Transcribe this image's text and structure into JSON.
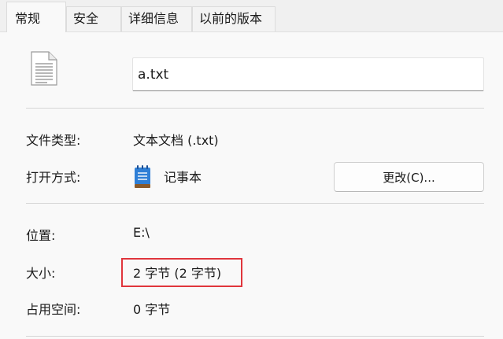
{
  "tabs": [
    {
      "label": "常规",
      "active": true
    },
    {
      "label": "安全",
      "active": false
    },
    {
      "label": "详细信息",
      "active": false
    },
    {
      "label": "以前的版本",
      "active": false
    }
  ],
  "file": {
    "name": "a.txt",
    "icon": "text-document-icon"
  },
  "properties": {
    "type_label": "文件类型:",
    "type_value": "文本文档 (.txt)",
    "openwith_label": "打开方式:",
    "openwith_value": "记事本",
    "openwith_icon": "notepad-icon",
    "change_button": "更改(C)...",
    "location_label": "位置:",
    "location_value": "E:\\",
    "size_label": "大小:",
    "size_value": "2 字节 (2 字节)",
    "size_on_disk_label": "占用空间:",
    "size_on_disk_value": "0 字节"
  },
  "colors": {
    "highlight": "#e0353c",
    "notepad_blue": "#2f7fd6"
  }
}
